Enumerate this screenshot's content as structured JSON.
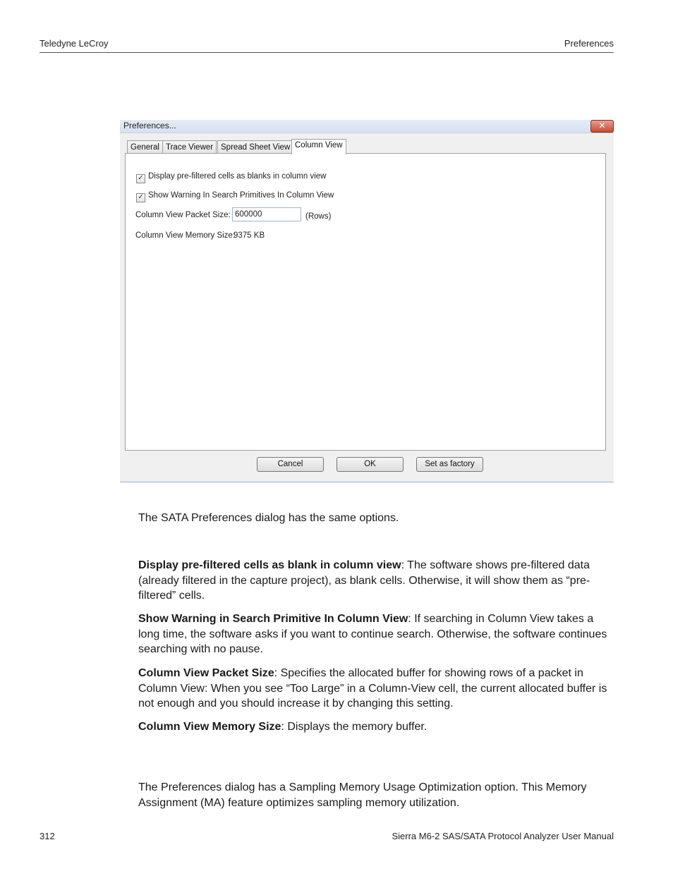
{
  "header": {
    "left": "Teledyne LeCroy",
    "right": "Preferences"
  },
  "dialog": {
    "title": "Preferences...",
    "close_glyph": "✕",
    "tabs": [
      "General",
      "Trace Viewer",
      "Spread Sheet View",
      "Column View"
    ],
    "active_tab": "Column View",
    "options": {
      "display_prefiltered": {
        "label": "Display pre-filtered cells as blanks in column view",
        "checked": true
      },
      "show_warning": {
        "label": "Show Warning In Search Primitives In Column View",
        "checked": true
      },
      "packet_size": {
        "label": "Column View Packet Size:",
        "value": "600000",
        "unit": "(Rows)"
      },
      "memory_size": {
        "label": "Column View Memory Size:",
        "value": "9375 KB"
      }
    },
    "buttons": {
      "cancel": "Cancel",
      "ok": "OK",
      "factory": "Set as factory"
    }
  },
  "body": {
    "intro": "The SATA Preferences dialog has the same options.",
    "items": [
      {
        "term": "Display pre-filtered cells as blank in column view",
        "text": ": The software shows pre-filtered data (already filtered in the capture project), as blank cells. Otherwise, it will show them as “pre-filtered” cells."
      },
      {
        "term": "Show Warning in Search Primitive In Column View",
        "text": ": If searching in Column View takes a long time, the software asks if you want to continue search. Otherwise, the software continues searching with no pause."
      },
      {
        "term": "Column View Packet Size",
        "text": ": Specifies the allocated buffer for showing rows of a packet in Column View: When you see “Too Large” in a Column-View cell, the current allocated buffer is not enough and you should increase it by changing this setting."
      },
      {
        "term": "Column View Memory Size",
        "text": ": Displays the memory buffer."
      }
    ],
    "closing": "The Preferences dialog has a Sampling Memory Usage Optimization option. This Memory Assignment (MA) feature optimizes sampling memory utilization."
  },
  "footer": {
    "page_number": "312",
    "manual_title": "Sierra M6-2 SAS/SATA Protocol Analyzer User Manual"
  }
}
